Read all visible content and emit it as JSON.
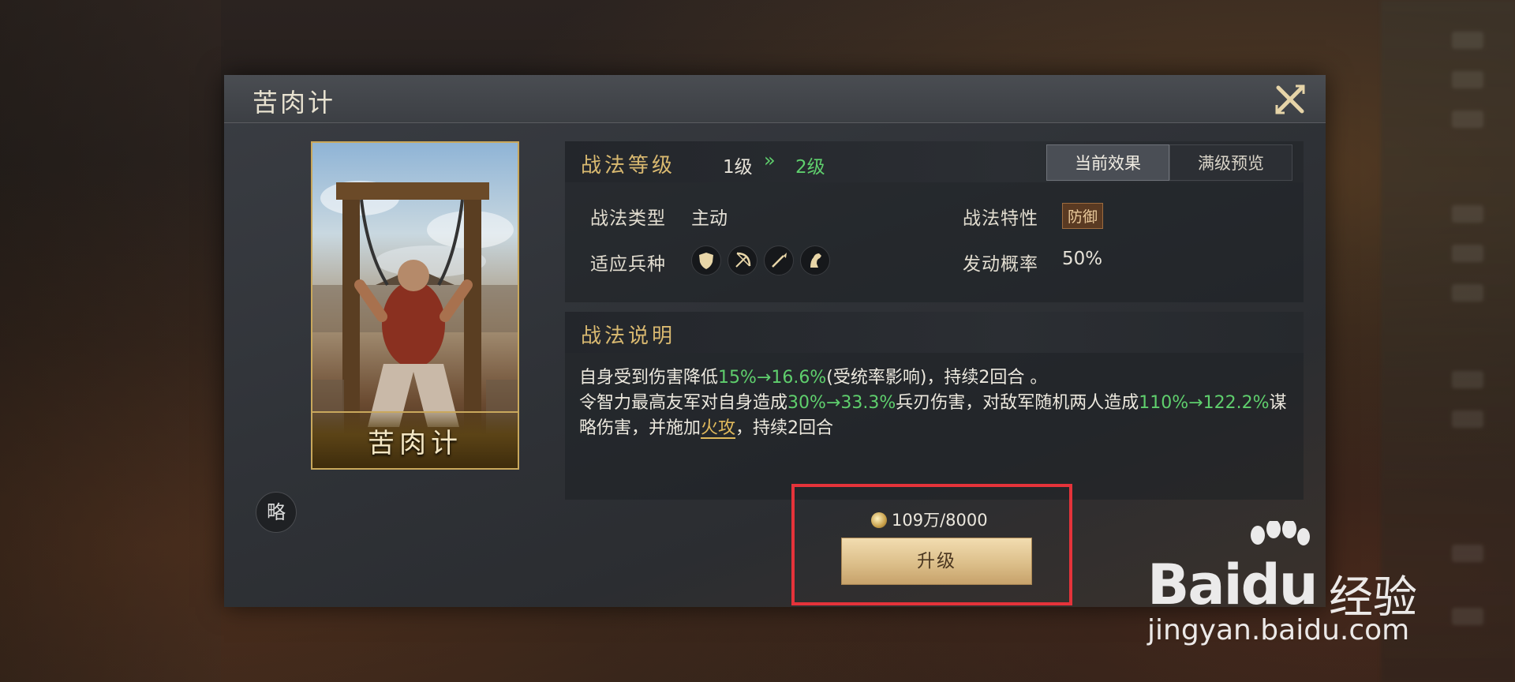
{
  "panel": {
    "title": "苦肉计",
    "card_name": "苦肉计",
    "badge": "略"
  },
  "info": {
    "level_label": "战法等级",
    "level_from": "1级",
    "level_arrow": "»",
    "level_to": "2级",
    "tabs": [
      "当前效果",
      "满级预览"
    ],
    "type_label": "战法类型",
    "type_value": "主动",
    "trait_label": "战法特性",
    "trait_value": "防御",
    "troops_label": "适应兵种",
    "troop_icons": [
      "shield-icon",
      "bow-icon",
      "spear-icon",
      "horse-icon"
    ],
    "prob_label": "发动概率",
    "prob_value": "50%"
  },
  "description": {
    "title": "战法说明",
    "line1_a": "自身受到伤害降低",
    "line1_g": "15%→16.6%",
    "line1_b": "(受统率影响)，持续2回合 。",
    "line2_a": "令智力最高友军对自身造成",
    "line2_g1": "30%→33.3%",
    "line2_b": "兵刃伤害，对敌军随机两人造成",
    "line2_g2": "110%→122.2%",
    "line2_c": "谋略伤害，并施加",
    "line2_link": "火攻",
    "line2_d": "，持续2回合"
  },
  "upgrade": {
    "cost": "109万/8000",
    "button": "升级"
  },
  "watermark": {
    "brand_a": "Bai",
    "brand_b": "du",
    "brand_cn": "经验",
    "url": "jingyan.baidu.com"
  },
  "colors": {
    "accent_gold": "#d9b970",
    "value_green": "#5fcf6d",
    "highlight_red": "#e5333a"
  }
}
